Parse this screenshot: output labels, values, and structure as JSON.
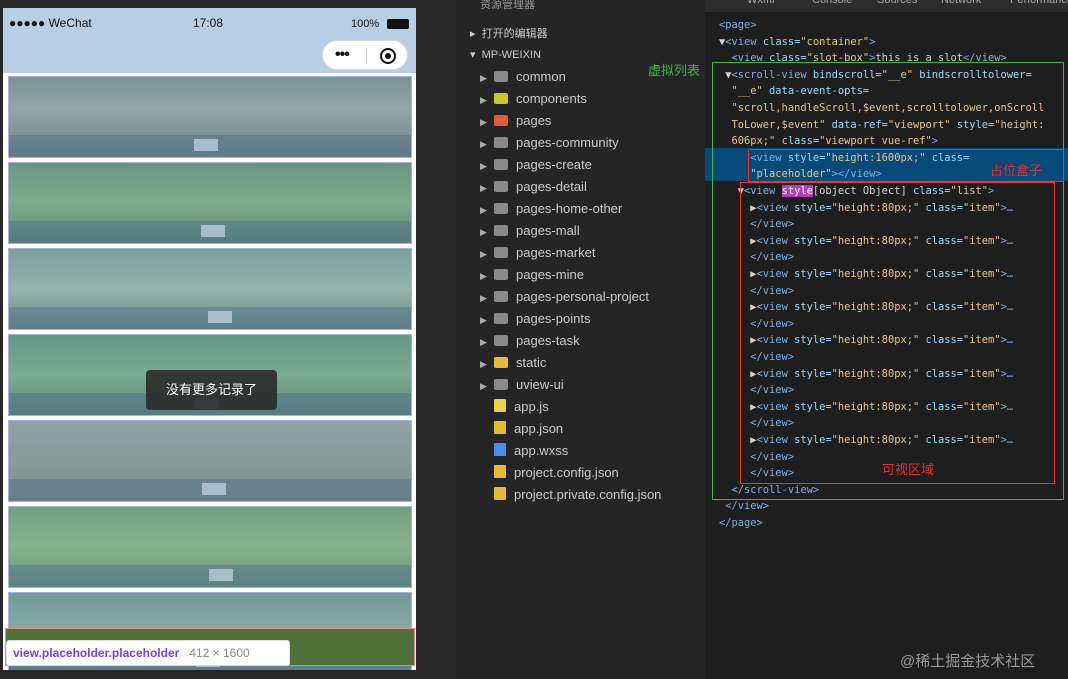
{
  "phone": {
    "carrier": "●●●●● WeChat",
    "time": "17:08",
    "battery": "100%",
    "toast": "没有更多记录了",
    "tip_selector": "view.placeholder.placeholder",
    "tip_size": "412 × 1600"
  },
  "explorer": {
    "header": "资源管理器",
    "open_editors": "打开的编辑器",
    "project": "MP-WEIXIN",
    "items": [
      {
        "label": "common",
        "kind": "folder",
        "color": "#8a8a8a"
      },
      {
        "label": "components",
        "kind": "folder",
        "color": "#c9c72c"
      },
      {
        "label": "pages",
        "kind": "folder",
        "color": "#e05e3a"
      },
      {
        "label": "pages-community",
        "kind": "folder",
        "color": "#8a8a8a"
      },
      {
        "label": "pages-create",
        "kind": "folder",
        "color": "#8a8a8a"
      },
      {
        "label": "pages-detail",
        "kind": "folder",
        "color": "#8a8a8a"
      },
      {
        "label": "pages-home-other",
        "kind": "folder",
        "color": "#8a8a8a"
      },
      {
        "label": "pages-mall",
        "kind": "folder",
        "color": "#8a8a8a"
      },
      {
        "label": "pages-market",
        "kind": "folder",
        "color": "#8a8a8a"
      },
      {
        "label": "pages-mine",
        "kind": "folder",
        "color": "#8a8a8a"
      },
      {
        "label": "pages-personal-project",
        "kind": "folder",
        "color": "#8a8a8a"
      },
      {
        "label": "pages-points",
        "kind": "folder",
        "color": "#8a8a8a"
      },
      {
        "label": "pages-task",
        "kind": "folder",
        "color": "#8a8a8a"
      },
      {
        "label": "static",
        "kind": "folder",
        "color": "#e8b83a"
      },
      {
        "label": "uview-ui",
        "kind": "folder",
        "color": "#8a8a8a"
      },
      {
        "label": "app.js",
        "kind": "file",
        "color": "#e8d44d"
      },
      {
        "label": "app.json",
        "kind": "file",
        "color": "#e8b83a"
      },
      {
        "label": "app.wxss",
        "kind": "file",
        "color": "#4a8fe8"
      },
      {
        "label": "project.config.json",
        "kind": "file",
        "color": "#e8b83a"
      },
      {
        "label": "project.private.config.json",
        "kind": "file",
        "color": "#e8b83a"
      }
    ]
  },
  "devtools": {
    "tabs": [
      "Wxml",
      "Console",
      "Sources",
      "Network",
      "Performance"
    ],
    "lines": [
      [
        {
          "t": "<page>",
          "c": "tag"
        }
      ],
      [
        {
          "t": "▼",
          "c": "txt"
        },
        {
          "t": "<view ",
          "c": "tag"
        },
        {
          "t": "class=",
          "c": "att"
        },
        {
          "t": "\"container\"",
          "c": "val"
        },
        {
          "t": ">",
          "c": "tag"
        }
      ],
      [
        {
          "t": "  <view ",
          "c": "tag"
        },
        {
          "t": "class=",
          "c": "att"
        },
        {
          "t": "\"slot-box\"",
          "c": "val"
        },
        {
          "t": ">",
          "c": "tag"
        },
        {
          "t": "this is a slot",
          "c": "txt"
        },
        {
          "t": "</view>",
          "c": "tag"
        }
      ],
      [
        {
          "t": " ▼",
          "c": "txt"
        },
        {
          "t": "<scroll-view ",
          "c": "tag"
        },
        {
          "t": "bindscroll=",
          "c": "att"
        },
        {
          "t": "\"__e\" ",
          "c": "val"
        },
        {
          "t": "bindscrolltolower=",
          "c": "att"
        }
      ],
      [
        {
          "t": "  \"__e\" ",
          "c": "val"
        },
        {
          "t": "data-event-opts=",
          "c": "att"
        }
      ],
      [
        {
          "t": "  \"scroll,handleScroll,$event,scrolltolower,onScroll",
          "c": "val"
        }
      ],
      [
        {
          "t": "  ToLower,$event\" ",
          "c": "val"
        },
        {
          "t": "data-ref=",
          "c": "att"
        },
        {
          "t": "\"viewport\" ",
          "c": "val"
        },
        {
          "t": "style=",
          "c": "att"
        },
        {
          "t": "\"height:",
          "c": "val"
        }
      ],
      [
        {
          "t": "  606px;\" ",
          "c": "val"
        },
        {
          "t": "class=",
          "c": "att"
        },
        {
          "t": "\"viewport vue-ref\"",
          "c": "val"
        },
        {
          "t": ">",
          "c": "tag"
        }
      ],
      [
        {
          "t": "     <view ",
          "c": "tag"
        },
        {
          "t": "style=",
          "c": "att"
        },
        {
          "t": "\"height:1600px;\" ",
          "c": "val"
        },
        {
          "t": "class=",
          "c": "att"
        }
      ],
      [
        {
          "t": "     \"placeholder\"",
          "c": "val"
        },
        {
          "t": "></view>",
          "c": "tag"
        }
      ],
      [
        {
          "t": "   ▼",
          "c": "txt"
        },
        {
          "t": "<view ",
          "c": "tag"
        },
        {
          "t": "style",
          "c": "att"
        },
        {
          "t": "[object Object] ",
          "c": "txt"
        },
        {
          "t": "class=",
          "c": "att"
        },
        {
          "t": "\"list\"",
          "c": "val"
        },
        {
          "t": ">",
          "c": "tag"
        }
      ],
      [
        {
          "t": "     ▶",
          "c": "txt"
        },
        {
          "t": "<view ",
          "c": "tag"
        },
        {
          "t": "style=",
          "c": "att"
        },
        {
          "t": "\"height:80px;\" ",
          "c": "val"
        },
        {
          "t": "class=",
          "c": "att"
        },
        {
          "t": "\"item\"",
          "c": "val"
        },
        {
          "t": ">…",
          "c": "tag"
        }
      ],
      [
        {
          "t": "     </view>",
          "c": "tag"
        }
      ],
      [
        {
          "t": "     ▶",
          "c": "txt"
        },
        {
          "t": "<view ",
          "c": "tag"
        },
        {
          "t": "style=",
          "c": "att"
        },
        {
          "t": "\"height:80px;\" ",
          "c": "val"
        },
        {
          "t": "class=",
          "c": "att"
        },
        {
          "t": "\"item\"",
          "c": "val"
        },
        {
          "t": ">…",
          "c": "tag"
        }
      ],
      [
        {
          "t": "     </view>",
          "c": "tag"
        }
      ],
      [
        {
          "t": "     ▶",
          "c": "txt"
        },
        {
          "t": "<view ",
          "c": "tag"
        },
        {
          "t": "style=",
          "c": "att"
        },
        {
          "t": "\"height:80px;\" ",
          "c": "val"
        },
        {
          "t": "class=",
          "c": "att"
        },
        {
          "t": "\"item\"",
          "c": "val"
        },
        {
          "t": ">…",
          "c": "tag"
        }
      ],
      [
        {
          "t": "     </view>",
          "c": "tag"
        }
      ],
      [
        {
          "t": "     ▶",
          "c": "txt"
        },
        {
          "t": "<view ",
          "c": "tag"
        },
        {
          "t": "style=",
          "c": "att"
        },
        {
          "t": "\"height:80px;\" ",
          "c": "val"
        },
        {
          "t": "class=",
          "c": "att"
        },
        {
          "t": "\"item\"",
          "c": "val"
        },
        {
          "t": ">…",
          "c": "tag"
        }
      ],
      [
        {
          "t": "     </view>",
          "c": "tag"
        }
      ],
      [
        {
          "t": "     ▶",
          "c": "txt"
        },
        {
          "t": "<view ",
          "c": "tag"
        },
        {
          "t": "style=",
          "c": "att"
        },
        {
          "t": "\"height:80px;\" ",
          "c": "val"
        },
        {
          "t": "class=",
          "c": "att"
        },
        {
          "t": "\"item\"",
          "c": "val"
        },
        {
          "t": ">…",
          "c": "tag"
        }
      ],
      [
        {
          "t": "     </view>",
          "c": "tag"
        }
      ],
      [
        {
          "t": "     ▶",
          "c": "txt"
        },
        {
          "t": "<view ",
          "c": "tag"
        },
        {
          "t": "style=",
          "c": "att"
        },
        {
          "t": "\"height:80px;\" ",
          "c": "val"
        },
        {
          "t": "class=",
          "c": "att"
        },
        {
          "t": "\"item\"",
          "c": "val"
        },
        {
          "t": ">…",
          "c": "tag"
        }
      ],
      [
        {
          "t": "     </view>",
          "c": "tag"
        }
      ],
      [
        {
          "t": "     ▶",
          "c": "txt"
        },
        {
          "t": "<view ",
          "c": "tag"
        },
        {
          "t": "style=",
          "c": "att"
        },
        {
          "t": "\"height:80px;\" ",
          "c": "val"
        },
        {
          "t": "class=",
          "c": "att"
        },
        {
          "t": "\"item\"",
          "c": "val"
        },
        {
          "t": ">…",
          "c": "tag"
        }
      ],
      [
        {
          "t": "     </view>",
          "c": "tag"
        }
      ],
      [
        {
          "t": "     ▶",
          "c": "txt"
        },
        {
          "t": "<view ",
          "c": "tag"
        },
        {
          "t": "style=",
          "c": "att"
        },
        {
          "t": "\"height:80px;\" ",
          "c": "val"
        },
        {
          "t": "class=",
          "c": "att"
        },
        {
          "t": "\"item\"",
          "c": "val"
        },
        {
          "t": ">…",
          "c": "tag"
        }
      ],
      [
        {
          "t": "     </view>",
          "c": "tag"
        }
      ],
      [
        {
          "t": "     </view>",
          "c": "tag"
        }
      ],
      [
        {
          "t": "  </scroll-view>",
          "c": "tag"
        }
      ],
      [
        {
          "t": " </view>",
          "c": "tag"
        }
      ],
      [
        {
          "t": "</page>",
          "c": "tag"
        }
      ]
    ]
  },
  "annotations": {
    "virtual_list": "虚拟列表",
    "placeholder_box": "占位盒子",
    "visible_area": "可视区域",
    "green": "#3fb54a",
    "red": "#e33333"
  },
  "watermark": "@稀土掘金技术社区"
}
